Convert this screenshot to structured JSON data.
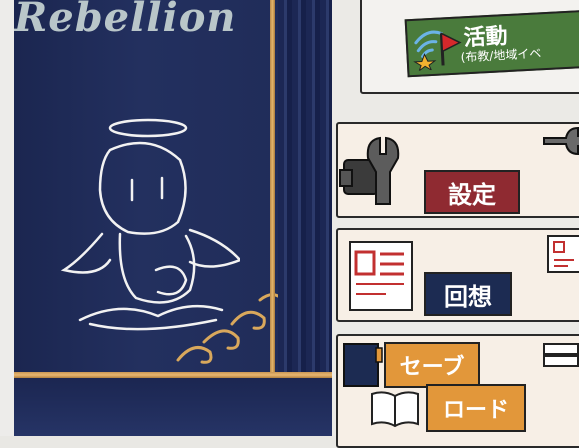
{
  "book": {
    "title": "Rebellion"
  },
  "menu": {
    "activity": {
      "title": "活動",
      "subtitle": "(布教/地域イベ",
      "icon": "wifi-flag-icon"
    },
    "settings": {
      "label": "設定",
      "icon": "wrench-icon"
    },
    "recall": {
      "label": "回想",
      "icon": "memo-icon"
    },
    "save": {
      "label": "セーブ",
      "icon": "notebook-icon"
    },
    "load": {
      "label": "ロード",
      "icon": "open-book-icon"
    }
  },
  "colors": {
    "book_blue": "#1f2b57",
    "gold": "#e6b56a",
    "activity_green": "#4a7b3c",
    "settings_red": "#8f2a31",
    "recall_navy": "#1c2b52",
    "save_orange": "#e2973a"
  }
}
